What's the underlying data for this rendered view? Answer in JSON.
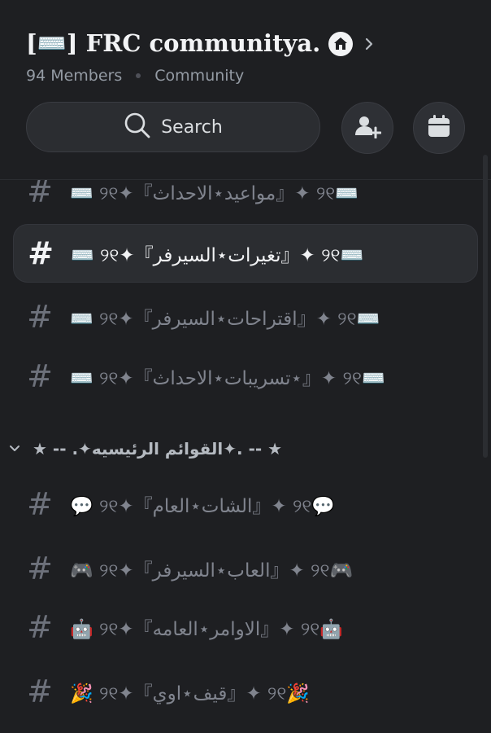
{
  "server": {
    "title": "[⌨️] FRC communitya.",
    "members": "94 Members",
    "type": "Community"
  },
  "search": {
    "label": "Search"
  },
  "icons": {
    "home_badge": "home-icon",
    "invite": "add-user-icon",
    "events": "calendar-icon",
    "search": "search-icon",
    "chevron": "chevron-right-icon",
    "category_chevron": "chevron-down-icon"
  },
  "channels_top": [
    {
      "hash": "#",
      "name": "⌨️ ୨୧✦『مواعيد⋆الاحداث』✦ ୨୧⌨️",
      "active": false
    },
    {
      "hash": "#",
      "name": "⌨️ ୨୧✦『تغيرات⋆السيرفر』✦ ୨୧⌨️",
      "active": true
    },
    {
      "hash": "#",
      "name": "⌨️ ୨୧✦『اقتراحات⋆السيرفر』✦ ୨୧⌨️",
      "active": false
    },
    {
      "hash": "#",
      "name": "⌨️ ୨୧✦『تسريبات⋆الاحداث⋆』✦ ୨୧⌨️",
      "active": false
    }
  ],
  "category": {
    "name": "★ --  .✦القوائم الرئيسيه✦.  -- ★"
  },
  "channels_main": [
    {
      "hash": "#",
      "name": "💬 ୨୧✦『الشات⋆العام』✦ ୨୧💬"
    },
    {
      "hash": "#",
      "name": "🎮 ୨୧✦『العاب⋆السيرفر』✦ ୨୧🎮"
    },
    {
      "hash": "#",
      "name": "🤖 ୨୧✦『الاوامر⋆العامه』✦ ୨୧🤖"
    },
    {
      "hash": "#",
      "name": "🎉 ୨୧✦『قيف⋆اوي』✦ ୨୧🎉"
    }
  ],
  "colors": {
    "background": "#1e1f22",
    "active_row": "#2b2d31",
    "muted_text": "#80848e",
    "bright_text": "#f2f3f5"
  }
}
